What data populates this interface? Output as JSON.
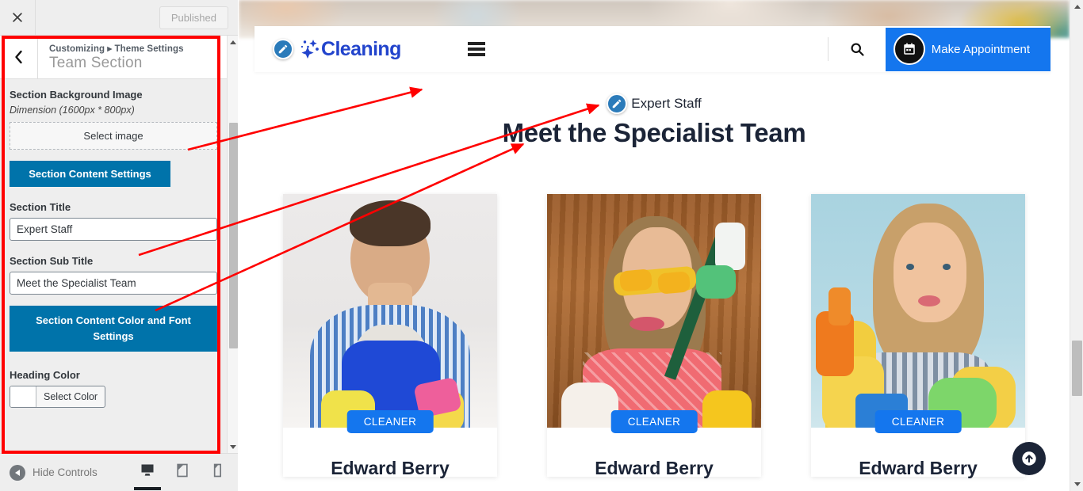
{
  "customizer": {
    "close_icon": "close-icon",
    "published_label": "Published",
    "back_icon": "chevron-left-icon",
    "breadcrumb": "Customizing ▸ Theme Settings",
    "panel_title": "Team Section",
    "controls": {
      "bg_image_label": "Section Background Image",
      "bg_image_dimension": "Dimension (1600px * 800px)",
      "select_image_label": "Select image",
      "content_settings_button": "Section Content Settings",
      "section_title_label": "Section Title",
      "section_title_value": "Expert Staff",
      "section_subtitle_label": "Section Sub Title",
      "section_subtitle_value": "Meet the Specialist Team",
      "color_font_button": "Section Content Color and Font Settings",
      "heading_color_label": "Heading Color",
      "select_color_label": "Select Color"
    },
    "footer": {
      "hide_controls_label": "Hide Controls",
      "devices": [
        {
          "name": "desktop-preview",
          "icon": "desktop-icon",
          "active": true
        },
        {
          "name": "tablet-preview",
          "icon": "tablet-icon",
          "active": false
        },
        {
          "name": "mobile-preview",
          "icon": "mobile-icon",
          "active": false
        }
      ]
    },
    "accent_color": "#0073aa",
    "annotation_color": "#ff0000"
  },
  "preview": {
    "header": {
      "logo_text": "Cleaning",
      "logo_icon": "sparkle-icon",
      "edit_badge_icon": "pencil-edit-icon",
      "menu_icon": "hamburger-menu-icon",
      "search_icon": "search-icon",
      "appointment_icon": "calendar-icon",
      "appointment_label": "Make Appointment",
      "button_color": "#1476ee",
      "logo_color": "#2244cc"
    },
    "section": {
      "edit_badge_icon": "pencil-edit-icon",
      "sub_title": "Expert Staff",
      "title": "Meet the Specialist Team"
    },
    "team": [
      {
        "role": "CLEANER",
        "name": "Edward Berry",
        "photo": "male-cleaner-blue-apron"
      },
      {
        "role": "CLEANER",
        "name": "Edward Berry",
        "photo": "female-cleaner-yellow-goggles"
      },
      {
        "role": "CLEANER",
        "name": "Edward Berry",
        "photo": "female-cleaner-gloves-spray"
      }
    ],
    "scroll_top_icon": "arrow-up-circle-icon"
  }
}
